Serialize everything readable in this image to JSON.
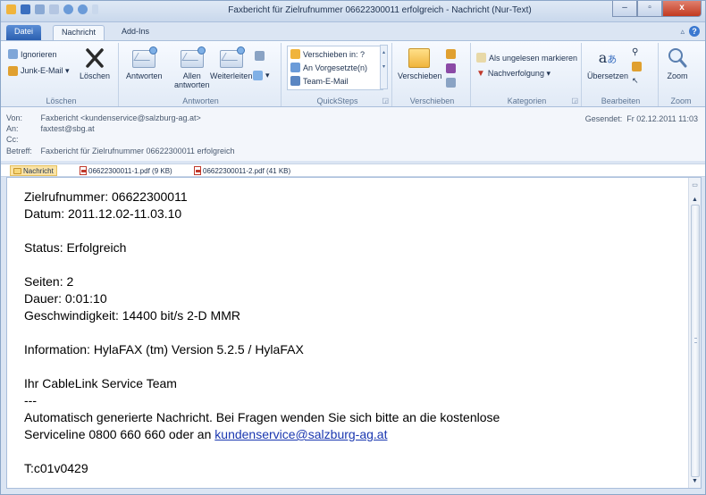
{
  "window": {
    "title": "Faxbericht für Zielrufnummer 06622300011 erfolgreich - Nachricht (Nur-Text)",
    "minimize": "‒",
    "maximize": "▫",
    "close": "x"
  },
  "tabs": {
    "file": "Datei",
    "message": "Nachricht",
    "addins": "Add-Ins"
  },
  "ribbon": {
    "loeschen": {
      "ignore": "Ignorieren",
      "junk": "Junk-E-Mail ▾",
      "delete": "Löschen",
      "label": "Löschen"
    },
    "antworten": {
      "reply": "Antworten",
      "reply_all_1": "Allen",
      "reply_all_2": "antworten",
      "forward": "Weiterleiten",
      "label": "Antworten"
    },
    "quicksteps": {
      "move_to": "Verschieben in: ?",
      "to_manager": "An Vorgesetzte(n)",
      "team_mail": "Team-E-Mail",
      "label": "QuickSteps"
    },
    "verschieben": {
      "move": "Verschieben",
      "label": "Verschieben"
    },
    "kategorien": {
      "mark_unread": "Als ungelesen markieren",
      "follow_up": "Nachverfolgung ▾",
      "label": "Kategorien"
    },
    "bearbeiten": {
      "translate": "Übersetzen",
      "label": "Bearbeiten"
    },
    "zoom": {
      "zoom": "Zoom",
      "label": "Zoom"
    }
  },
  "header": {
    "from_label": "Von:",
    "from_value": "Faxbericht <kundenservice@salzburg-ag.at>",
    "to_label": "An:",
    "to_value": "faxtest@sbg.at",
    "cc_label": "Cc:",
    "cc_value": "",
    "subject_label": "Betreff:",
    "subject_value": "Faxbericht für Zielrufnummer 06622300011 erfolgreich",
    "sent_label": "Gesendet:",
    "sent_value": "Fr 02.12.2011 11:03"
  },
  "attachments": {
    "message": "Nachricht",
    "file1": "06622300011-1.pdf (9 KB)",
    "file2": "06622300011-2.pdf (41 KB)"
  },
  "body": {
    "line1": "Zielrufnummer: 06622300011",
    "line2": "Datum: 2011.12.02-11.03.10",
    "line3": "Status: Erfolgreich",
    "line4": "Seiten: 2",
    "line5": "Dauer: 0:01:10",
    "line6": "Geschwindigkeit: 14400 bit/s 2-D MMR",
    "line7": "Information: HylaFAX (tm) Version 5.2.5 / HylaFAX",
    "line8": "Ihr CableLink Service Team",
    "line9": "---",
    "line10": "Automatisch generierte Nachricht. Bei Fragen wenden Sie sich bitte an die kostenlose",
    "line11_pre": "Serviceline 0800 660 660 oder an ",
    "line11_link": "kundenservice@salzburg-ag.at",
    "line12": "T:c01v0429"
  },
  "colors": {
    "accent": "#2b5fb0",
    "link": "#1a37b0",
    "close_button": "#c23a20"
  }
}
